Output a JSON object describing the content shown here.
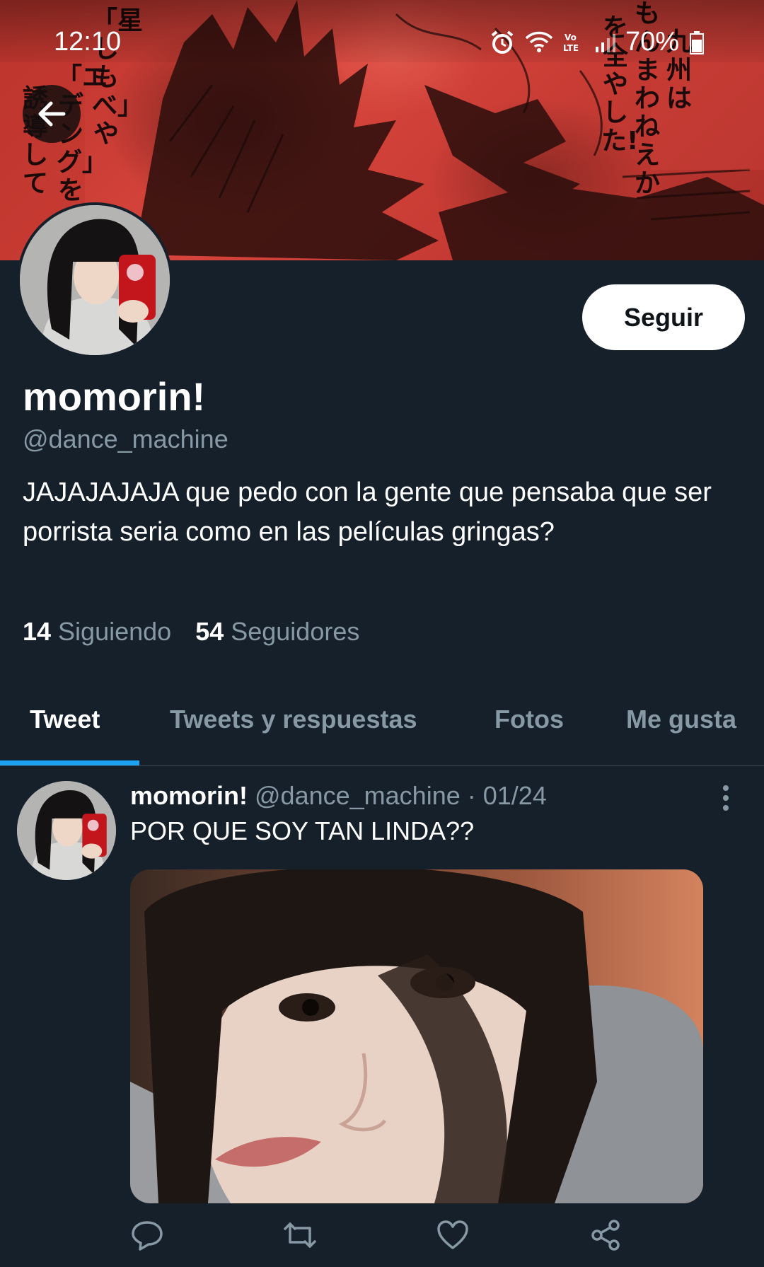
{
  "status_bar": {
    "time": "12:10",
    "battery_percent": "70%",
    "icons": [
      "alarm-icon",
      "wifi-icon",
      "volte-icon",
      "signal-icon",
      "battery-icon"
    ]
  },
  "navigation": {
    "back_icon": "arrow-left-icon"
  },
  "banner": {
    "manga_text_left": [
      "「星しもべ」や",
      "「エデング」を",
      "誘導して"
    ],
    "manga_text_right": [
      "九州は",
      "もんまわねえか",
      "を全やした!"
    ]
  },
  "profile": {
    "display_name": "momorin!",
    "handle": "@dance_machine",
    "follow_label": "Seguir",
    "bio": "JAJAJAJAJA que pedo con la gente que pensaba que ser porrista seria como en las películas gringas?",
    "following_count": "14",
    "following_label": "Siguiendo",
    "followers_count": "54",
    "followers_label": "Seguidores"
  },
  "tabs": [
    {
      "label": "Tweet",
      "active": true
    },
    {
      "label": "Tweets y respuestas",
      "active": false
    },
    {
      "label": "Fotos",
      "active": false
    },
    {
      "label": "Me gusta",
      "active": false
    }
  ],
  "tweet": {
    "name": "momorin!",
    "handle": "@dance_machine",
    "separator": " · ",
    "date": "01/24",
    "text": "POR QUE SOY TAN LINDA??",
    "actions": [
      "reply-icon",
      "retweet-icon",
      "like-icon",
      "share-icon"
    ]
  },
  "colors": {
    "background": "#15202b",
    "secondary_text": "#8899a6",
    "accent": "#1da1f2",
    "banner_red": "#c8413a"
  }
}
